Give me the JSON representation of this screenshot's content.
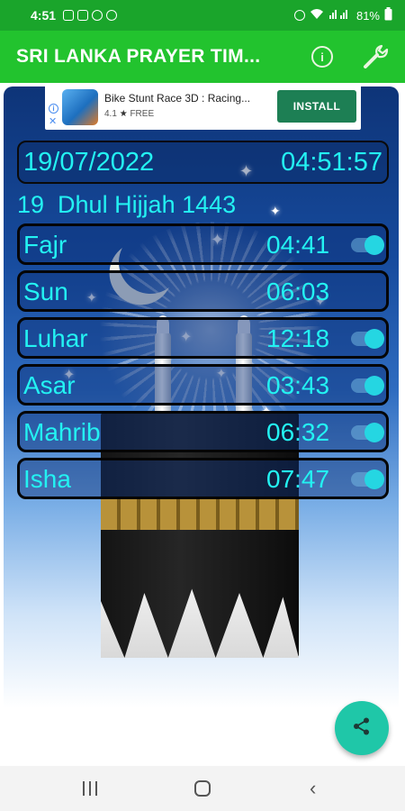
{
  "status_bar": {
    "time": "4:51",
    "battery": "81%"
  },
  "app_bar": {
    "title": "SRI LANKA PRAYER TIM...",
    "info_icon": "info-icon",
    "settings_icon": "wrench-icon"
  },
  "ad": {
    "title": "Bike Stunt Race 3D : Racing...",
    "rating": "4.1",
    "price": "FREE",
    "install_label": "INSTALL",
    "star_glyph": "★"
  },
  "datetime": {
    "date": "19/07/2022",
    "time": "04:51:57"
  },
  "hijri_date": "19  Dhul Hijjah 1443",
  "prayers": [
    {
      "name": "Fajr",
      "time": "04:41"
    },
    {
      "name": "Sun",
      "time": "06:03"
    },
    {
      "name": "Luhar",
      "time": "12:18"
    },
    {
      "name": "Asar",
      "time": "03:43"
    },
    {
      "name": "Mahrib",
      "time": "06:32"
    },
    {
      "name": "Isha",
      "time": "07:47"
    }
  ],
  "colors": {
    "accent_green": "#22c32e",
    "text_cyan": "#23f2f2",
    "fab_teal": "#1fc7a8"
  },
  "fab": {
    "icon": "share-icon"
  }
}
